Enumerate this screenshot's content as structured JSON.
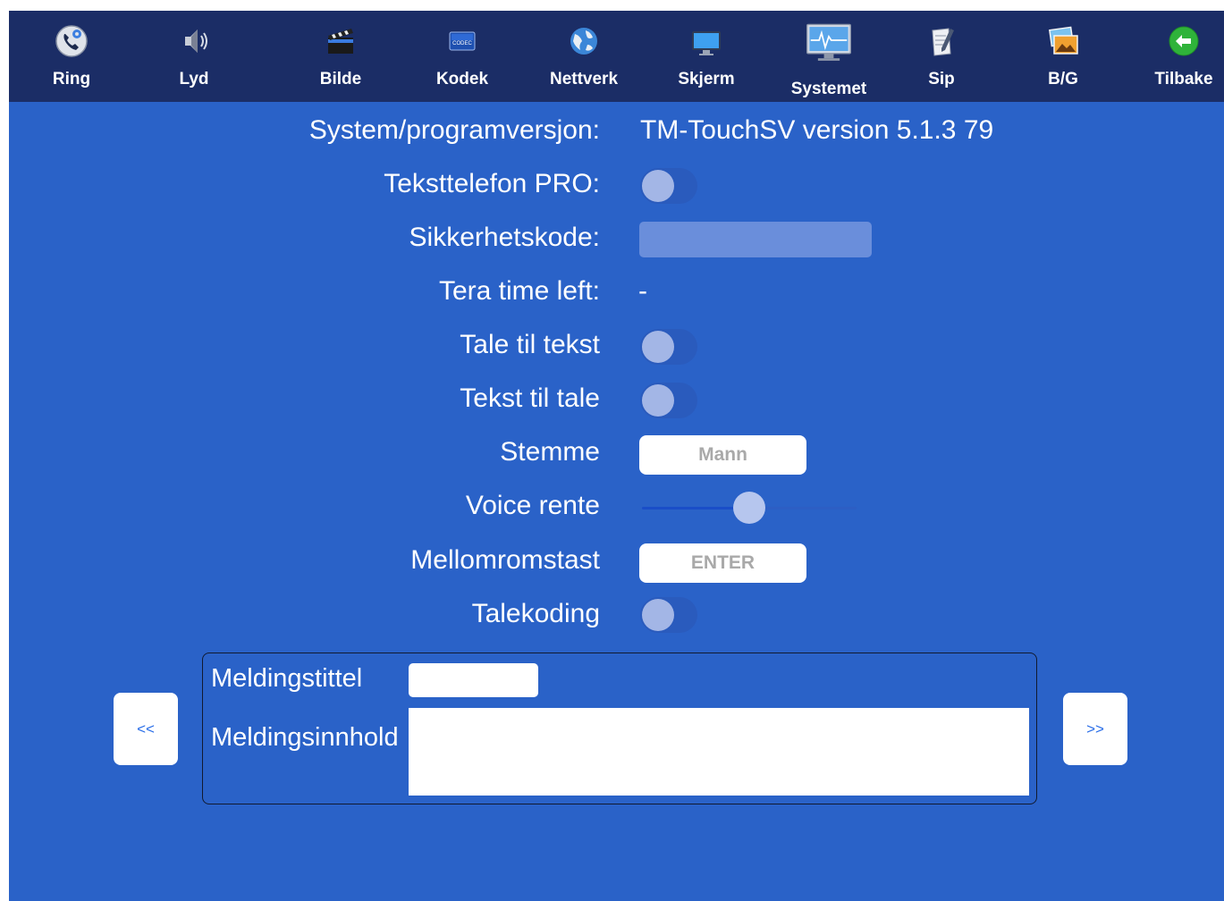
{
  "toolbar": {
    "items": [
      {
        "label": "Ring",
        "icon": "phone-gear-icon"
      },
      {
        "label": "Lyd",
        "icon": "speaker-icon"
      },
      {
        "label": "Bilde",
        "icon": "clapperboard-icon"
      },
      {
        "label": "Kodek",
        "icon": "codec-chip-icon"
      },
      {
        "label": "Nettverk",
        "icon": "globe-icon"
      },
      {
        "label": "Skjerm",
        "icon": "monitor-icon"
      },
      {
        "label": "Systemet",
        "icon": "system-monitor-icon",
        "active": true
      },
      {
        "label": "Sip",
        "icon": "notepad-icon"
      },
      {
        "label": "B/G",
        "icon": "photos-icon"
      },
      {
        "label": "Tilbake",
        "icon": "back-arrow-icon"
      }
    ],
    "codec_icon_text": "CODEC"
  },
  "settings": {
    "version_label": "System/programversjon:",
    "version_value": "TM-TouchSV version 5.1.3 79",
    "teksttelefon_label": "Teksttelefon PRO:",
    "teksttelefon_on": false,
    "security_label": "Sikkerhetskode:",
    "security_value": "",
    "tera_label": "Tera time left:",
    "tera_value": "-",
    "tale_til_tekst_label": "Tale til tekst",
    "tale_til_tekst_on": false,
    "tekst_til_tale_label": "Tekst til tale",
    "tekst_til_tale_on": false,
    "stemme_label": "Stemme",
    "stemme_value": "Mann",
    "voice_rate_label": "Voice rente",
    "voice_rate_fraction": 0.5,
    "mellomrom_label": "Mellomromstast",
    "mellomrom_value": "ENTER",
    "talekoding_label": "Talekoding",
    "talekoding_on": false
  },
  "message": {
    "title_label": "Meldingstittel",
    "title_value": "",
    "content_label": "Meldingsinnhold",
    "content_value": ""
  },
  "nav": {
    "prev_label": "<<",
    "next_label": ">>"
  },
  "colors": {
    "background": "#2a62c8",
    "toolbar": "#1b2d66",
    "accent": "#2a6ee8"
  }
}
